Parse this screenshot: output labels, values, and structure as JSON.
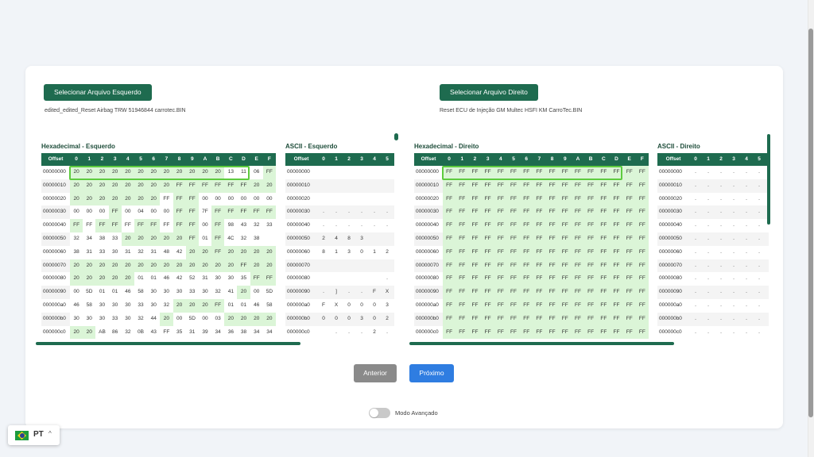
{
  "left": {
    "button": "Selecionar Arquivo Esquerdo",
    "file_name": "edited_edited_Reset Airbag TRW 51946844 carrotec.BIN",
    "hex_title": "Hexadecimal - Esquerdo",
    "ascii_title": "ASCII - Esquerdo"
  },
  "right": {
    "button": "Selecionar Arquivo Direito",
    "file_name": "Reset ECU de Injeção GM Multec HSFI KM CarroTec.BIN",
    "hex_title": "Hexadecimal - Direito",
    "ascii_title": "ASCII - Direito"
  },
  "hex_header": [
    "Offset",
    "0",
    "1",
    "2",
    "3",
    "4",
    "5",
    "6",
    "7",
    "8",
    "9",
    "A",
    "B",
    "C",
    "D",
    "E",
    "F"
  ],
  "ascii_header": [
    "Offset",
    "0",
    "1",
    "2",
    "3",
    "4",
    "5"
  ],
  "offsets": [
    "00000000",
    "00000010",
    "00000020",
    "00000030",
    "00000040",
    "00000050",
    "00000060",
    "00000070",
    "00000080",
    "00000090",
    "000000a0",
    "000000b0",
    "000000c0"
  ],
  "left_hex": [
    [
      "20",
      "20",
      "20",
      "20",
      "20",
      "20",
      "20",
      "20",
      "20",
      "20",
      "20",
      "20",
      "13",
      "11",
      "06",
      "FF",
      "20"
    ],
    [
      "20",
      "20",
      "20",
      "20",
      "20",
      "20",
      "20",
      "20",
      "FF",
      "FF",
      "FF",
      "FF",
      "FF",
      "FF",
      "20",
      "20"
    ],
    [
      "20",
      "20",
      "20",
      "20",
      "20",
      "20",
      "20",
      "FF",
      "FF",
      "FF",
      "00",
      "00",
      "00",
      "00",
      "00",
      "00"
    ],
    [
      "00",
      "00",
      "00",
      "FF",
      "00",
      "04",
      "00",
      "00",
      "FF",
      "FF",
      "7F",
      "FF",
      "FF",
      "FF",
      "FF",
      "FF"
    ],
    [
      "FF",
      "FF",
      "FF",
      "FF",
      "FF",
      "FF",
      "FF",
      "FF",
      "FF",
      "FF",
      "00",
      "FF",
      "98",
      "43",
      "32",
      "33"
    ],
    [
      "32",
      "34",
      "38",
      "33",
      "20",
      "20",
      "20",
      "20",
      "20",
      "FF",
      "01",
      "FF",
      "4C",
      "32",
      "38"
    ],
    [
      "38",
      "31",
      "33",
      "30",
      "31",
      "32",
      "31",
      "48",
      "42",
      "20",
      "20",
      "FF",
      "20",
      "20",
      "20",
      "20"
    ],
    [
      "20",
      "20",
      "20",
      "20",
      "20",
      "20",
      "20",
      "20",
      "20",
      "20",
      "20",
      "20",
      "20",
      "FF",
      "20",
      "20"
    ],
    [
      "20",
      "20",
      "20",
      "20",
      "20",
      "01",
      "01",
      "46",
      "42",
      "52",
      "31",
      "30",
      "30",
      "35",
      "FF",
      "FF"
    ],
    [
      "00",
      "5D",
      "01",
      "01",
      "46",
      "58",
      "30",
      "30",
      "30",
      "33",
      "30",
      "32",
      "41",
      "20",
      "00",
      "5D"
    ],
    [
      "46",
      "58",
      "30",
      "30",
      "30",
      "33",
      "30",
      "32",
      "20",
      "20",
      "20",
      "FF",
      "01",
      "01",
      "46",
      "58"
    ],
    [
      "30",
      "30",
      "30",
      "33",
      "30",
      "32",
      "44",
      "20",
      "00",
      "5D",
      "00",
      "03",
      "20",
      "20",
      "20",
      "20"
    ],
    [
      "20",
      "20",
      "AB",
      "86",
      "32",
      "0B",
      "43",
      "FF",
      "35",
      "31",
      "39",
      "34",
      "36",
      "38",
      "34",
      "34"
    ]
  ],
  "right_hex_row": [
    "FF",
    "FF",
    "FF",
    "FF",
    "FF",
    "FF",
    "FF",
    "FF",
    "FF",
    "FF",
    "FF",
    "FF",
    "FF",
    "FF",
    "FF",
    "FF"
  ],
  "left_ascii": [
    [
      "",
      "",
      "",
      "",
      "",
      ""
    ],
    [
      "",
      "",
      "",
      "",
      "",
      ""
    ],
    [
      "",
      "",
      "",
      "",
      "",
      ""
    ],
    [
      ".",
      ".",
      ".",
      ".",
      ".",
      "."
    ],
    [
      ".",
      ".",
      ".",
      ".",
      ".",
      "."
    ],
    [
      "2",
      "4",
      "8",
      "3",
      "",
      ""
    ],
    [
      "8",
      "1",
      "3",
      "0",
      "1",
      "2"
    ],
    [
      "",
      "",
      "",
      "",
      "",
      ""
    ],
    [
      "",
      "",
      "",
      "",
      "",
      "."
    ],
    [
      ".",
      "]",
      ".",
      ".",
      "F",
      "X"
    ],
    [
      "F",
      "X",
      "0",
      "0",
      "0",
      "3"
    ],
    [
      "0",
      "0",
      "0",
      "3",
      "0",
      "2"
    ],
    [
      "",
      ".",
      ".",
      ".",
      "2",
      "."
    ]
  ],
  "right_ascii_row": [
    ".",
    ".",
    ".",
    ".",
    ".",
    "."
  ],
  "nav": {
    "prev": "Anterior",
    "next": "Próximo"
  },
  "toggle_label": "Modo Avançado",
  "lang": {
    "code": "PT"
  },
  "colors": {
    "primary": "#1e6b4f",
    "next": "#2f7de1",
    "prev": "#8a8a8a",
    "match": "#dbf5d7",
    "highlight": "#5ecb3f"
  }
}
